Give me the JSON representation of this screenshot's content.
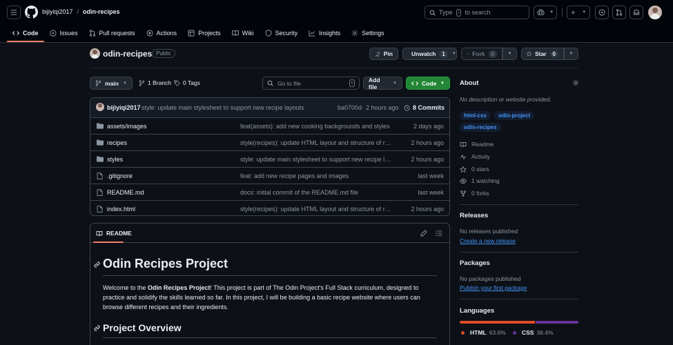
{
  "header": {
    "owner": "bijiyiqi2017",
    "separator": "/",
    "repo": "odin-recipes",
    "search_placeholder": "Type",
    "search_shortcut": "/",
    "search_suffix": "to search"
  },
  "tabs": [
    {
      "label": "Code",
      "icon": "code-icon"
    },
    {
      "label": "Issues",
      "icon": "issue-icon"
    },
    {
      "label": "Pull requests",
      "icon": "pull-request-icon"
    },
    {
      "label": "Actions",
      "icon": "play-icon"
    },
    {
      "label": "Projects",
      "icon": "table-icon"
    },
    {
      "label": "Wiki",
      "icon": "book-icon"
    },
    {
      "label": "Security",
      "icon": "shield-icon"
    },
    {
      "label": "Insights",
      "icon": "graph-icon"
    },
    {
      "label": "Settings",
      "icon": "gear-icon"
    }
  ],
  "repo": {
    "name": "odin-recipes",
    "visibility": "Public",
    "pin_label": "Pin",
    "unwatch_label": "Unwatch",
    "watch_count": "1",
    "fork_label": "Fork",
    "fork_count": "0",
    "star_label": "Star",
    "star_count": "0"
  },
  "toolbar": {
    "branch": "main",
    "branches": "1 Branch",
    "tags": "0 Tags",
    "goto_placeholder": "Go to file",
    "goto_shortcut": "t",
    "add_file": "Add file",
    "code": "Code"
  },
  "commit": {
    "author": "bijiyiqi2017",
    "message": "style: update main stylesheet to support new recipe layouts",
    "hash": "ba0700d",
    "dot": "·",
    "time": "2 hours ago",
    "count": "8 Commits"
  },
  "files": [
    {
      "name": "assets/images",
      "type": "folder",
      "message": "feat(assets): add new cooking backgrounds and styles",
      "time": "2 days ago"
    },
    {
      "name": "recipes",
      "type": "folder",
      "message": "style(recipes): update HTML layout and structure of reci...",
      "time": "2 hours ago"
    },
    {
      "name": "styles",
      "type": "folder",
      "message": "style: update main stylesheet to support new recipe layo...",
      "time": "2 hours ago"
    },
    {
      "name": ".gitignore",
      "type": "file",
      "message": "feat: add new recipe pages and images",
      "time": "last week"
    },
    {
      "name": "README.md",
      "type": "file",
      "message": "docs: initial commit of the README.md file",
      "time": "last week"
    },
    {
      "name": "index.html",
      "type": "file",
      "message": "style(recipes): update HTML layout and structure of reci...",
      "time": "2 hours ago"
    }
  ],
  "readme": {
    "tab": "README",
    "h1": "Odin Recipes Project",
    "p1_pre": "Welcome to the ",
    "p1_bold": "Odin Recipes Project",
    "p1_line1_rest": "! This project is part of The Odin Project's Full Stack curriculum, designed to",
    "p1_line2": "practice and solidify the skills learned so far. In this project, I will be building a basic recipe website where users can",
    "p1_line3": "browse different recipes and their ingredients.",
    "h2": "Project Overview"
  },
  "about": {
    "title": "About",
    "description": "No description or website provided.",
    "topics": [
      "html-css",
      "odin-project",
      "odin-recipes"
    ],
    "items": [
      {
        "label": "Readme",
        "icon": "book-icon"
      },
      {
        "label": "Activity",
        "icon": "pulse-icon"
      },
      {
        "label": "0 stars",
        "icon": "star-icon"
      },
      {
        "label": "1 watching",
        "icon": "eye-icon"
      },
      {
        "label": "0 forks",
        "icon": "fork-icon"
      }
    ]
  },
  "releases": {
    "title": "Releases",
    "text": "No releases published",
    "link": "Create a new release"
  },
  "packages": {
    "title": "Packages",
    "text": "No packages published",
    "link": "Publish your first package"
  },
  "languages": {
    "title": "Languages",
    "items": [
      {
        "name": "HTML",
        "percent": "63.6%",
        "value": 63.6,
        "color": "#e34c26"
      },
      {
        "name": "CSS",
        "percent": "36.4%",
        "value": 36.4,
        "color": "#663399"
      }
    ]
  }
}
